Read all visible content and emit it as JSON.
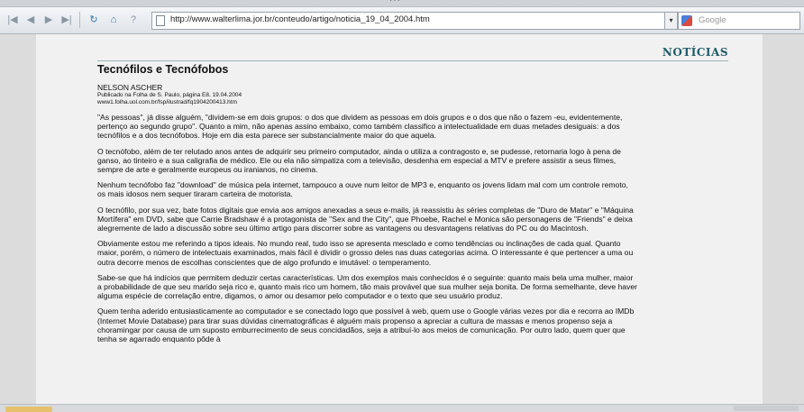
{
  "browser": {
    "url": "http://www.walterlima.jor.br/conteudo/artigo/noticia_19_04_2004.htm",
    "search_placeholder": "Google"
  },
  "site": {
    "section_label": "NOTÍCIAS"
  },
  "article": {
    "title": "Tecnófilos e Tecnófobos",
    "author": "NELSON ASCHER",
    "published": "Publicado na Folha de S. Paulo, página E8, 19.04.2004",
    "source_url": "www1.folha.uol.com.br/fsp/ilustrad/fq1904200413.htm",
    "paragraphs": [
      "\"As pessoas\", já disse alguém, \"dividem-se em dois grupos: o dos que dividem as pessoas em dois grupos e o dos que não o fazem -eu, evidentemente, pertenço ao segundo grupo\". Quanto a mim, não apenas assino embaixo, como também classifico a intelectualidade em duas metades desiguais: a dos tecnófilos e a dos tecnófobos. Hoje em dia esta parece ser substancialmente maior do que aquela.",
      "O tecnófobo, além de ter relutado anos antes de adquirir seu primeiro computador, ainda o utiliza a contragosto e, se pudesse, retornaria logo à pena de ganso, ao tinteiro e a sua caligrafia de médico. Ele ou ela não simpatiza com a televisão, desdenha em especial a MTV e prefere assistir a seus filmes, sempre de arte e geralmente europeus ou iranianos, no cinema.",
      "Nenhum tecnófobo faz \"download\" de música pela internet, tampouco a ouve num leitor de MP3 e, enquanto os jovens lidam mal com um controle remoto, os mais idosos nem sequer tiraram carteira de motorista.",
      "O tecnófilo, por sua vez, bate fotos digitais que envia aos amigos anexadas a seus e-mails, já reassistiu às séries completas de \"Duro de Matar\" e \"Máquina Mortífera\" em DVD, sabe que Carrie Bradshaw é a protagonista de \"Sex and the City\", que Phoebe, Rachel e Monica são personagens de \"Friends\" e deixa alegremente de lado a discussão sobre seu último artigo para discorrer sobre as vantagens ou desvantagens relativas do PC ou do Macintosh.",
      "Obviamente estou me referindo a tipos ideais. No mundo real, tudo isso se apresenta mesclado e como tendências ou inclinações de cada qual. Quanto maior, porém, o número de intelectuais examinados, mais fácil é dividir o grosso deles nas duas categorias acima. O interessante é que pertencer a uma ou outra decorre menos de escolhas conscientes que de algo profundo e imutável: o temperamento.",
      "Sabe-se que há indícios que permitem deduzir certas características. Um dos exemplos mais conhecidos é o seguinte: quanto mais bela uma mulher, maior a probabilidade de que seu marido seja rico e, quanto mais rico um homem, tão mais provável que sua mulher seja bonita. De forma semelhante, deve haver alguma espécie de correlação entre, digamos, o amor ou desamor pelo computador e o texto que seu usuário produz.",
      "Quem tenha aderido entusiasticamente ao computador e se conectado logo que possível à web, quem use o Google várias vezes por dia e recorra ao IMDb (Internet Movie Database) para tirar suas dúvidas cinematográficas é alguém mais propenso a apreciar a cultura de massas e menos propenso seja a choramingar por causa de um suposto emburrecimento de seus concidadãos, seja a atribuí-lo aos meios de comunicação. Por outro lado, quem quer que tenha se agarrado enquanto pôde à"
    ]
  }
}
